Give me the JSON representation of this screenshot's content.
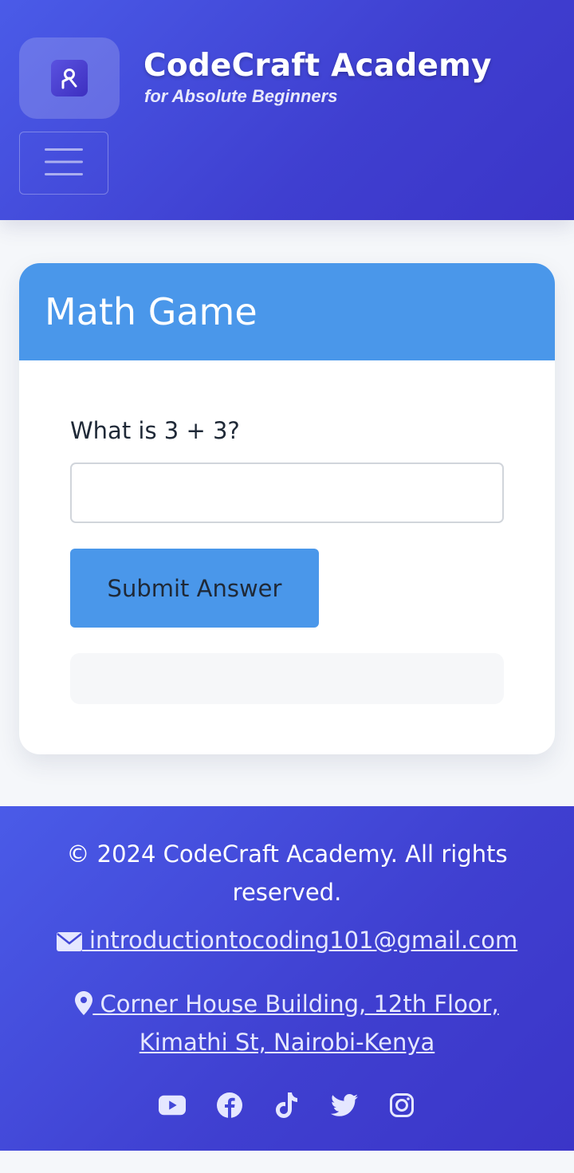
{
  "header": {
    "brand_title": "CodeCraft Academy",
    "brand_subtitle": "for Absolute Beginners",
    "logo_icon": "graduate-icon",
    "menu_icon": "hamburger-menu-icon",
    "gradient_start": "#4a5be8",
    "gradient_end": "#3b35c8"
  },
  "game": {
    "title": "Math Game",
    "question": "What is 3 + 3?",
    "answer_value": "",
    "submit_label": "Submit Answer",
    "result_text": "",
    "accent_color": "#4a97ea"
  },
  "footer": {
    "copyright": "© 2024 CodeCraft Academy. All rights reserved.",
    "email": "introductiontocoding101@gmail.com",
    "email_icon": "envelope-icon",
    "address": "Corner House Building, 12th Floor, Kimathi St, Nairobi-Kenya",
    "address_icon": "map-pin-icon",
    "socials": [
      "youtube-icon",
      "facebook-icon",
      "tiktok-icon",
      "twitter-icon",
      "instagram-icon"
    ]
  }
}
